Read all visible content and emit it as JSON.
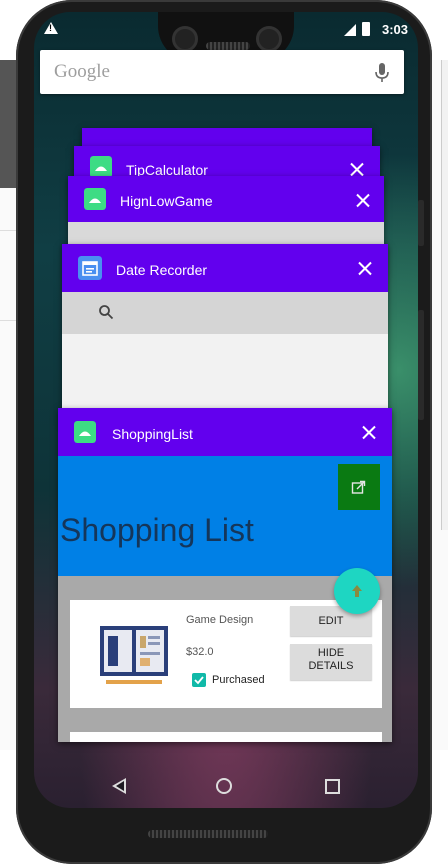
{
  "status": {
    "time": "3:03"
  },
  "search": {
    "logo": "Google"
  },
  "recents": [
    {
      "title": "TipCalculator"
    },
    {
      "title": "HignLowGame"
    },
    {
      "title": "Date Recorder"
    },
    {
      "title": "ShoppingList"
    }
  ],
  "shopping": {
    "heading": "Shopping List",
    "item": {
      "name": "Game Design",
      "price": "$32.0",
      "purchased_label": "Purchased",
      "purchased": true,
      "edit_label": "EDIT",
      "hide_label_1": "HIDE",
      "hide_label_2": "DETAILS"
    }
  },
  "colors": {
    "app_bar": "#6200ee",
    "shopping_header": "#0080e6",
    "fab": "#1ed6c2",
    "share_button": "#0a7a12"
  }
}
